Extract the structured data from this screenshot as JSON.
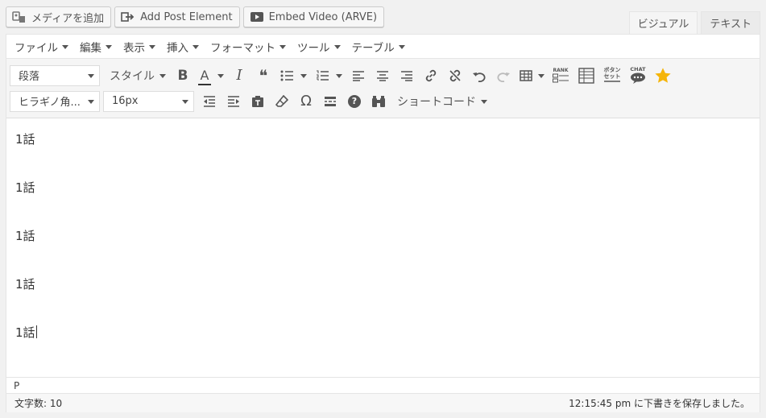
{
  "media_buttons": [
    {
      "label": "メディアを追加",
      "icon": "media-icon"
    },
    {
      "label": "Add Post Element",
      "icon": "post-element-icon"
    },
    {
      "label": "Embed Video (ARVE)",
      "icon": "video-icon"
    }
  ],
  "tabs": {
    "visual": "ビジュアル",
    "text": "テキスト",
    "active": "visual"
  },
  "menubar": [
    "ファイル",
    "編集",
    "表示",
    "挿入",
    "フォーマット",
    "ツール",
    "テーブル"
  ],
  "toolbar1": {
    "format_select": "段落",
    "style_dropdown": "スタイル",
    "buttons": [
      "bold",
      "text-color",
      "italic",
      "blockquote",
      "bullet-list",
      "numbered-list",
      "align-left",
      "align-center",
      "align-right",
      "link",
      "unlink",
      "undo",
      "redo",
      "table",
      "rank",
      "table-grid",
      "button-set",
      "chat",
      "star"
    ],
    "rank_label": "RANK",
    "button_label": "ボタン",
    "set_label": "セット",
    "chat_label": "CHAT",
    "bold_glyph": "B",
    "color_glyph": "A",
    "italic_glyph": "I",
    "quote_glyph": "❝"
  },
  "toolbar2": {
    "font_select": "ヒラギノ角...",
    "size_select": "16px",
    "omega_glyph": "Ω",
    "help_glyph": "?",
    "shortcode_dropdown": "ショートコード"
  },
  "content": {
    "paragraphs": [
      "1話",
      "1話",
      "1話",
      "1話",
      "1話"
    ]
  },
  "path": "P",
  "status": {
    "word_count": "文字数: 10",
    "autosave": "12:15:45 pm に下書きを保存しました。"
  },
  "colors": {
    "star": "#f5b50a",
    "text_color_bar": "#333333"
  }
}
